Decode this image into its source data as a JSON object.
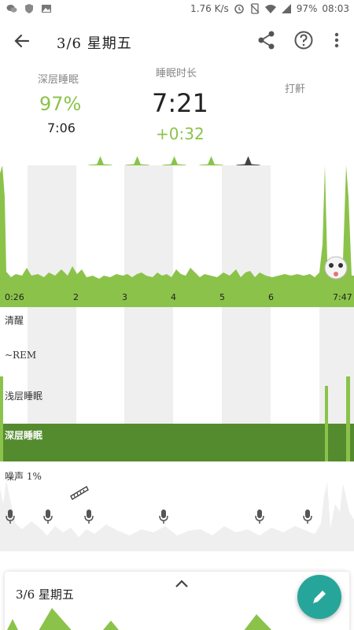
{
  "status_bar": {
    "network_speed": "1.76 K/s",
    "battery": "97%",
    "time": "08:03"
  },
  "app_bar": {
    "title": "3/6 星期五"
  },
  "summary": {
    "deep_sleep_label": "深层睡眠",
    "deep_sleep_percent": "97%",
    "deep_sleep_time": "7:06",
    "duration_label": "睡眠时长",
    "duration_value": "7:21",
    "duration_diff": "+0:32",
    "snore_label": "打鼾",
    "rating": 4,
    "rating_max": 5
  },
  "hypnogram_axis": [
    "0:26",
    "2",
    "3",
    "4",
    "5",
    "6",
    "7:47"
  ],
  "stages": {
    "awake": "清醒",
    "rem": "~REM",
    "light": "浅层睡眠",
    "deep": "深层睡眠"
  },
  "noise": {
    "label": "噪声 1%"
  },
  "card": {
    "title": "3/6 星期五"
  },
  "colors": {
    "accent_green": "#8bc34a",
    "deep_green": "#558b2f",
    "star_gray": "#424242",
    "fab_teal": "#26a69a"
  }
}
